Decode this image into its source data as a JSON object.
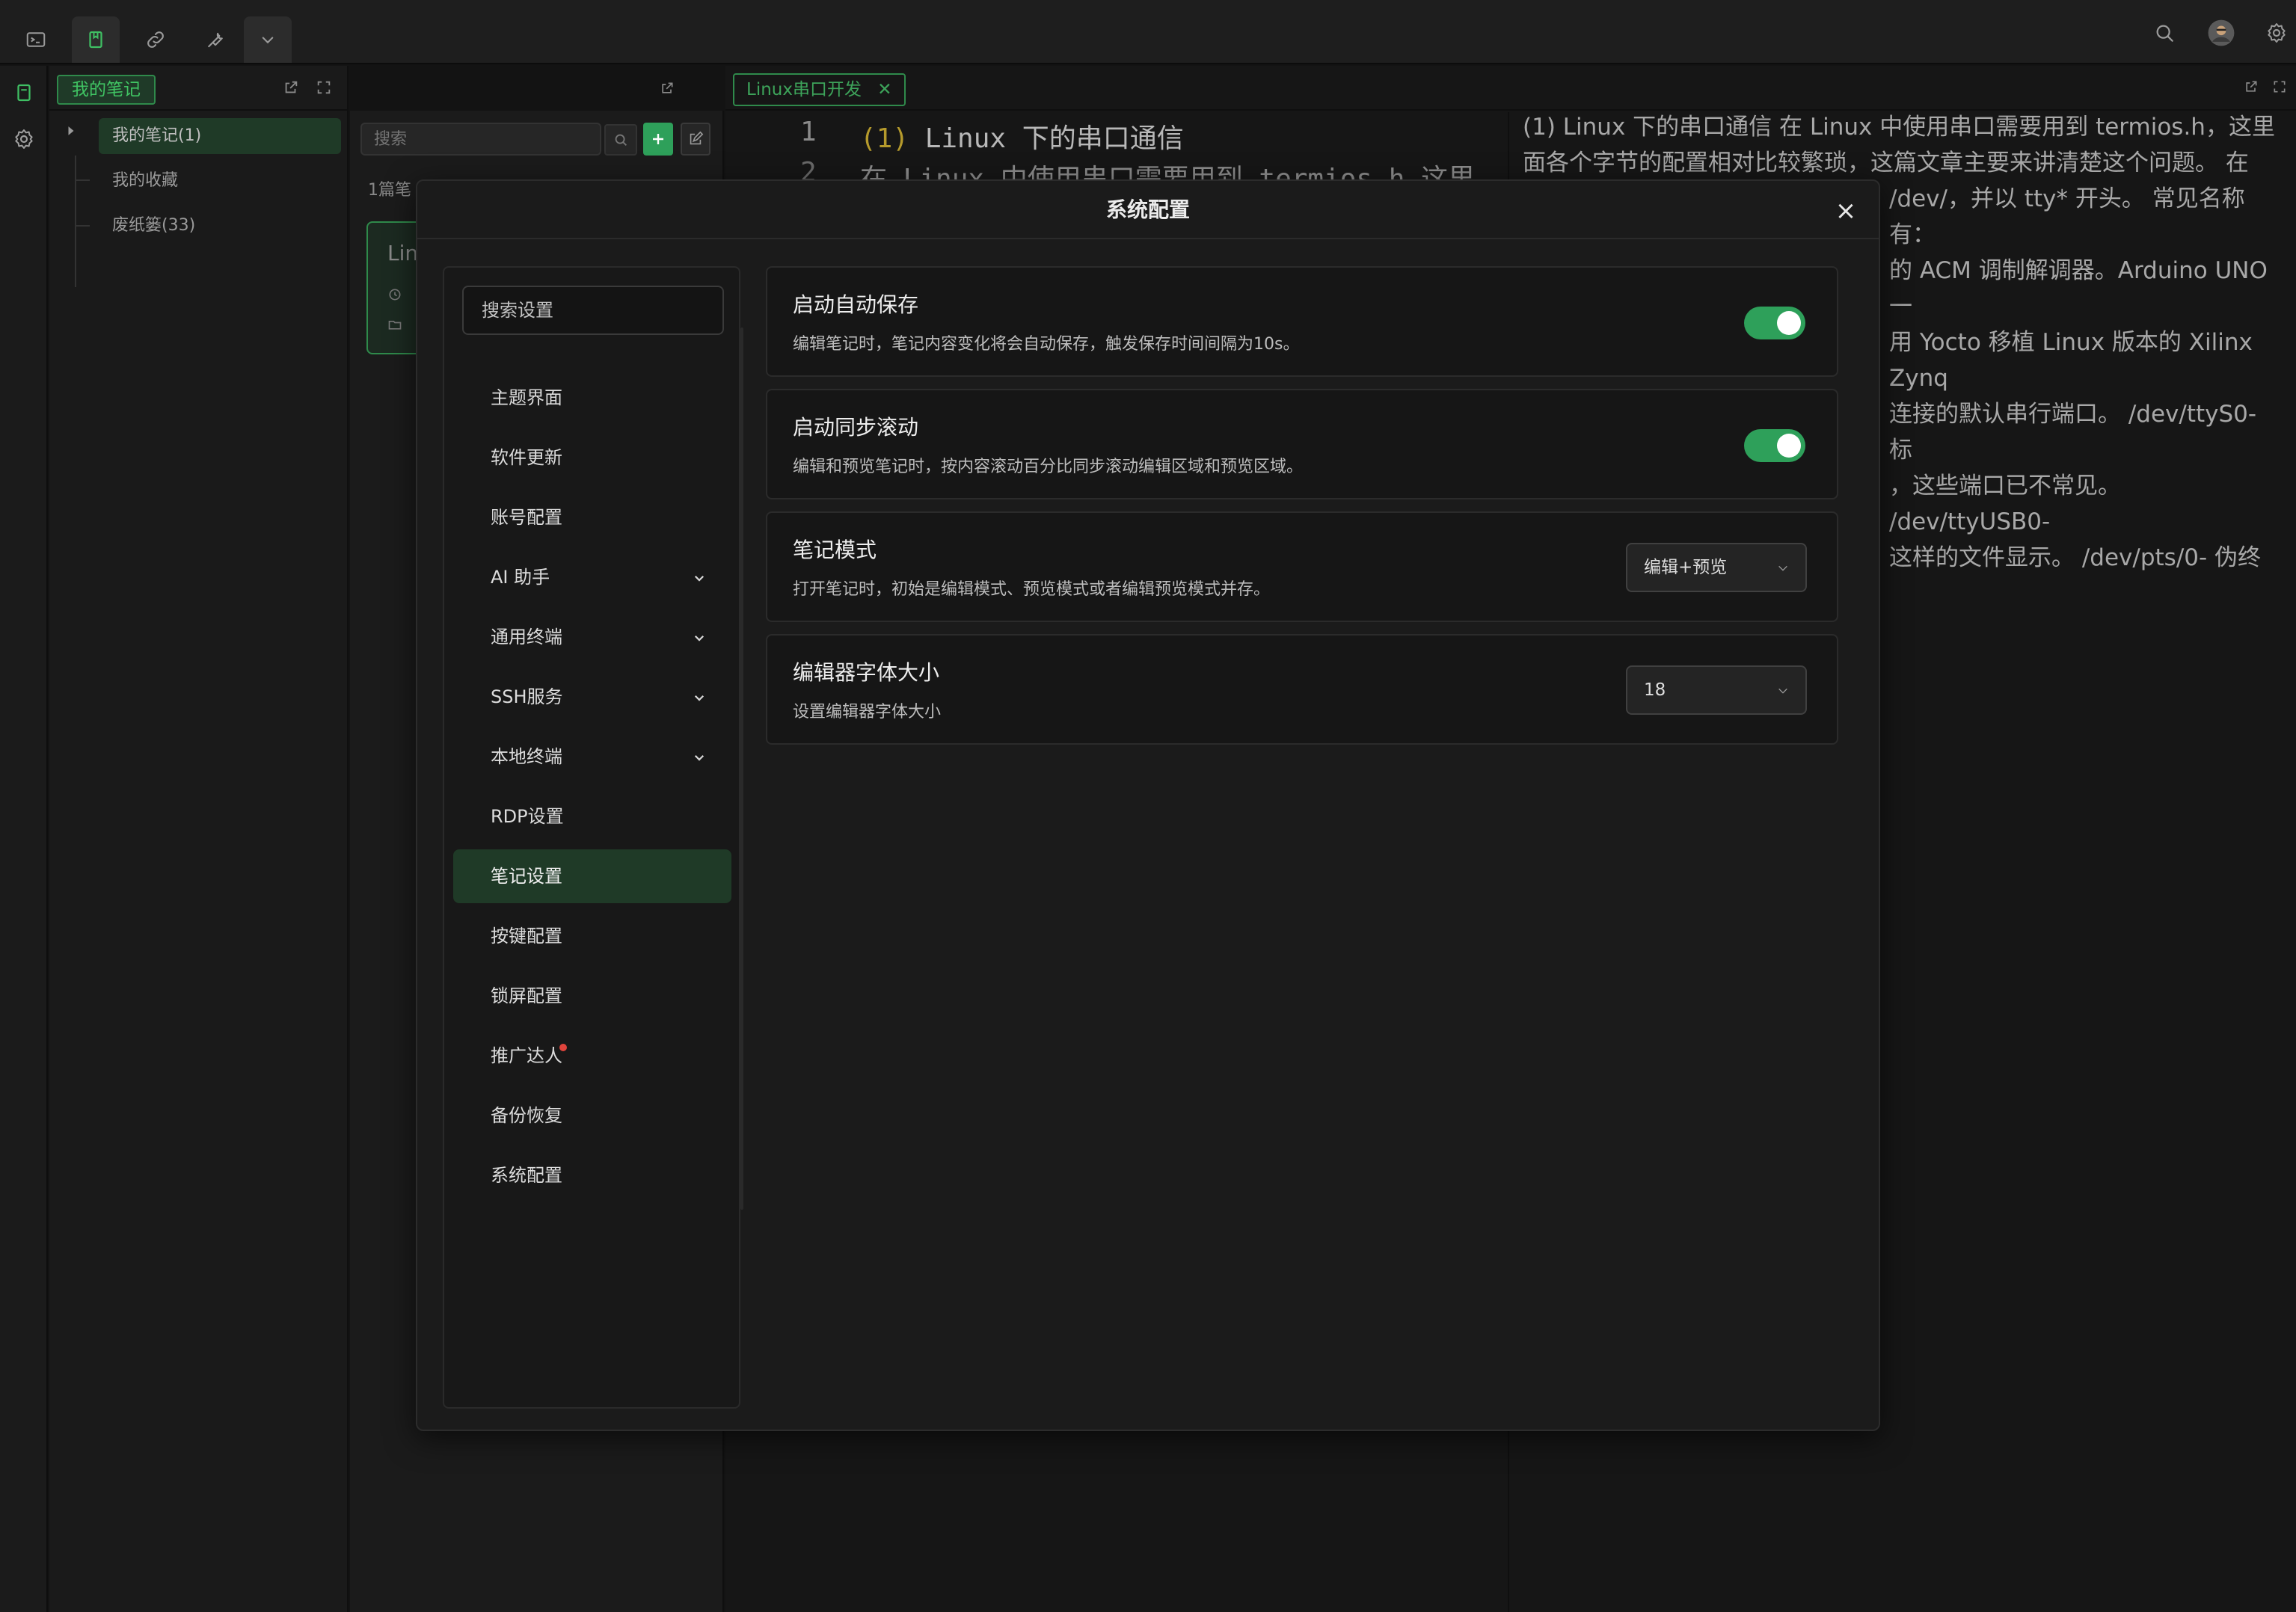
{
  "topbar": {
    "tools": [
      {
        "icon": "terminal-icon"
      },
      {
        "icon": "note-icon"
      },
      {
        "icon": "link-icon"
      },
      {
        "icon": "wrench-icon"
      },
      {
        "icon": "chevron-down-icon"
      }
    ],
    "right": [
      {
        "icon": "search-icon"
      },
      {
        "icon": "avatar"
      },
      {
        "icon": "settings-icon"
      }
    ]
  },
  "tree": {
    "title": "我的笔记",
    "items": [
      {
        "label": "我的笔记(1)"
      },
      {
        "label": "我的收藏"
      },
      {
        "label": "废纸篓(33)"
      }
    ]
  },
  "notelist": {
    "search_placeholder": "搜索",
    "count_label": "1篇笔",
    "card_title": "Lin"
  },
  "editor": {
    "tab_label": "Linux串口开发",
    "line_numbers": [
      "1",
      "2"
    ],
    "line1_prefix": "(1)",
    "line1_text": " Linux 下的串口通信",
    "line2_text": "在 Linux 中使用串口需要用到 termios.h 这里",
    "preview_lines": [
      "(1) Linux 下的串口通信 在 Linux 中使用串口需要用到 termios.h，这里",
      "面各个字节的配置相对比较繁琐，这篇文章主要来讲清楚这个问题。 在",
      "/dev/，并以 tty* 开头。 常见名称有：",
      "的 ACM 调制解调器。Arduino UNO 一",
      "用 Yocto 移植 Linux 版本的 Xilinx Zynq",
      "连接的默认串行端口。 /dev/ttyS0- 标",
      "，这些端口已不常见。 /dev/ttyUSB0-",
      "这样的文件显示。 /dev/pts/0- 伪终"
    ]
  },
  "modal": {
    "title": "系统配置",
    "close_label": "×",
    "search_placeholder": "搜索设置",
    "menu": [
      {
        "label": "主题界面",
        "expandable": false
      },
      {
        "label": "软件更新",
        "expandable": false
      },
      {
        "label": "账号配置",
        "expandable": false
      },
      {
        "label": "AI 助手",
        "expandable": true
      },
      {
        "label": "通用终端",
        "expandable": true
      },
      {
        "label": "SSH服务",
        "expandable": true
      },
      {
        "label": "本地终端",
        "expandable": true
      },
      {
        "label": "RDP设置",
        "expandable": false
      },
      {
        "label": "笔记设置",
        "expandable": false,
        "active": true
      },
      {
        "label": "按键配置",
        "expandable": false
      },
      {
        "label": "锁屏配置",
        "expandable": false
      },
      {
        "label": "推广达人",
        "expandable": false,
        "badge": true
      },
      {
        "label": "备份恢复",
        "expandable": false
      },
      {
        "label": "系统配置",
        "expandable": false
      }
    ],
    "settings": [
      {
        "title": "启动自动保存",
        "desc": "编辑笔记时，笔记内容变化将会自动保存，触发保存时间间隔为10s。",
        "control": "toggle",
        "on": true
      },
      {
        "title": "启动同步滚动",
        "desc": "编辑和预览笔记时，按内容滚动百分比同步滚动编辑区域和预览区域。",
        "control": "toggle",
        "on": true
      },
      {
        "title": "笔记模式",
        "desc": "打开笔记时，初始是编辑模式、预览模式或者编辑预览模式并存。",
        "control": "select",
        "value": "编辑+预览"
      },
      {
        "title": "编辑器字体大小",
        "desc": "设置编辑器字体大小",
        "control": "select",
        "value": "18"
      }
    ]
  },
  "colors": {
    "accent": "#2ea05a",
    "accent_text": "#40c463",
    "badge": "#e0443c"
  }
}
